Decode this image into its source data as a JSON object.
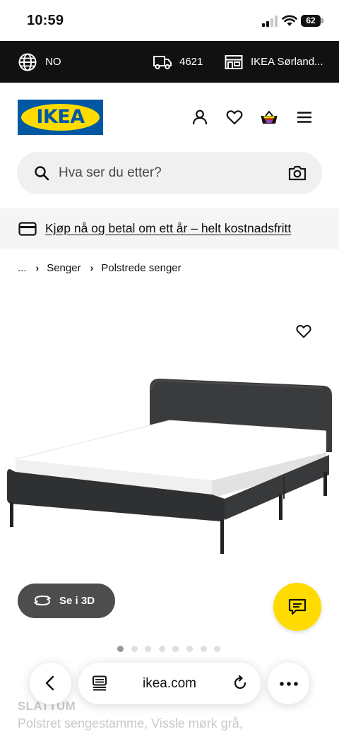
{
  "status_bar": {
    "time": "10:59",
    "battery": "62"
  },
  "topbar": {
    "language": "NO",
    "zip": "4621",
    "store": "IKEA Sørland..."
  },
  "header": {
    "logo_text": "IKEA"
  },
  "search": {
    "placeholder": "Hva ser du etter?"
  },
  "promo": {
    "text": "Kjøp nå og betal om ett år – helt kostnadsfritt"
  },
  "breadcrumb": {
    "ellipsis": "...",
    "items": [
      "Senger",
      "Polstrede senger"
    ]
  },
  "product": {
    "view_3d_label": "Se i 3D",
    "name": "SLATTUM",
    "description": "Polstret sengestamme, Vissle mørk grå,",
    "image_count": 8,
    "active_image": 1
  },
  "browser": {
    "url": "ikea.com"
  },
  "colors": {
    "ikea_blue": "#0058a3",
    "ikea_yellow": "#ffdb00",
    "topbar_bg": "#111111",
    "button_3d_bg": "#4d4d4d"
  },
  "icons": {
    "globe": "globe-icon",
    "truck": "truck-icon",
    "store": "store-icon",
    "account": "account-icon",
    "wishlist": "heart-icon",
    "cart": "basket-icon",
    "menu": "hamburger-icon",
    "search": "search-icon",
    "camera": "camera-icon",
    "card": "credit-card-icon",
    "chat": "chat-icon",
    "rotate": "rotate-3d-icon"
  }
}
